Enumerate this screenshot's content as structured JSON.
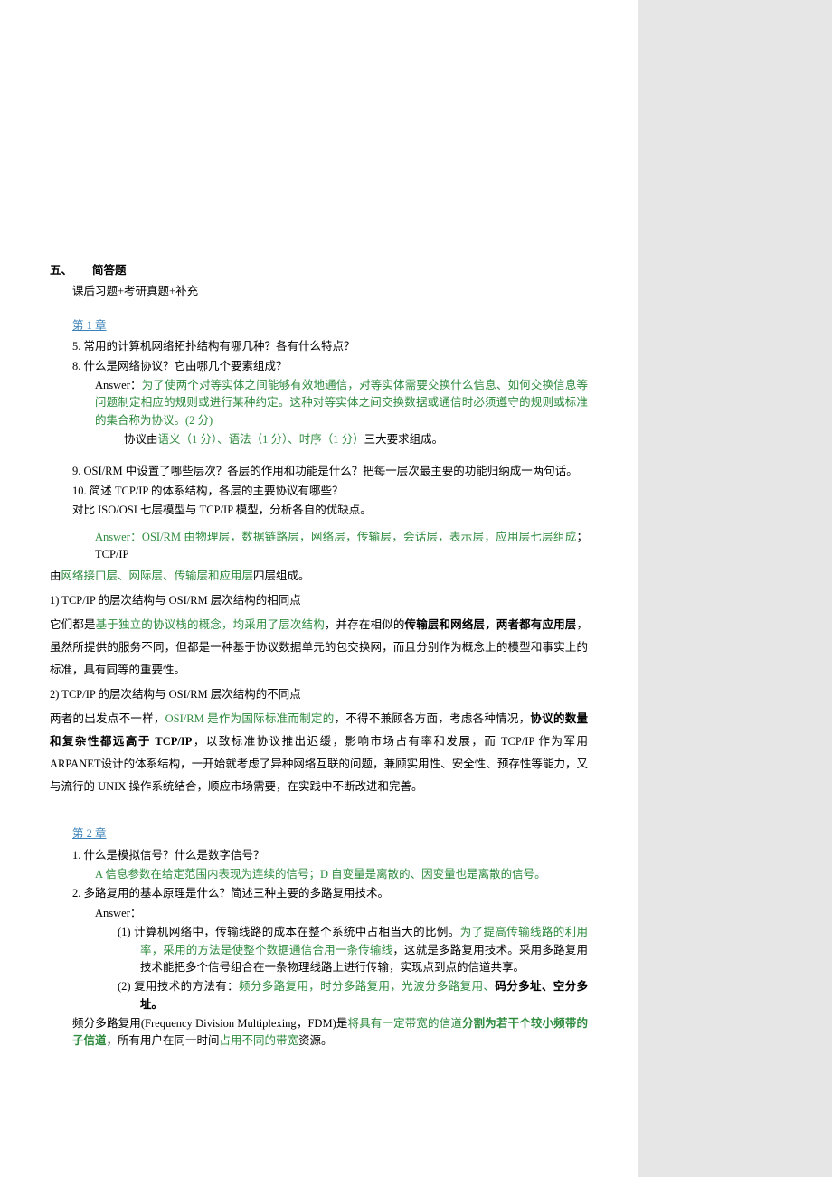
{
  "heading_num": "五、",
  "heading_text": "简答题",
  "subtitle": "课后习题+考研真题+补充",
  "chapter1": {
    "title": "第 1 章",
    "q5": "5.  常用的计算机网络拓扑结构有哪几种？各有什么特点？",
    "q8": "8.  什么是网络协议？它由哪几个要素组成？",
    "ans_label": "Answer：",
    "q8_a1": "为了使两个对等实体之间能够有效地通信，对等实体需要交换什么信息、如何交换信息等问题制定相应的规则或进行某种约定。这种对等实体之间交换数据或通信时必须遵守的规则或标准的集合称为协议。(2 分)",
    "q8_a2_pre": "协议由",
    "q8_a2_green": "语义（1 分）、语法（1 分）、时序（1 分）",
    "q8_a2_post": "三大要求组成。",
    "q9": "9.  OSI/RM 中设置了哪些层次？各层的作用和功能是什么？把每一层次最主要的功能归纳成一两句话。",
    "q10": "10. 简述 TCP/IP 的体系结构，各层的主要协议有哪些？",
    "compare": "对比 ISO/OSI 七层模型与 TCP/IP 模型，分析各自的优缺点。",
    "osi_ans_label": "Answer：",
    "osi_layers": "OSI/RM 由物理层，数据链路层，网络层，传输层，会话层，表示层，应用层七层组成",
    "osi_tcp_suffix": "；TCP/IP",
    "tcp_pre": "由",
    "tcp_layers": "网络接口层、网际层、传输层和应用层",
    "tcp_post": "四层组成。",
    "p1_title": "1) TCP/IP 的层次结构与 OSI/RM 层次结构的相同点",
    "p1_a": "它们都是",
    "p1_b": "基于独立的协议栈的概念，均采用了层次结构",
    "p1_c": "，并存在相似的",
    "p1_d": "传输层和网络层，两者都有应用层",
    "p1_e": "，虽然所提供的服务不同，但都是一种基于协议数据单元的包交换网，而且分别作为概念上的模型和事实上的标准，具有同等的重要性。",
    "p2_title": "2) TCP/IP 的层次结构与 OSI/RM 层次结构的不同点",
    "p2_a": "两者的出发点不一样，",
    "p2_b": "OSI/RM 是作为国际标准而制定的",
    "p2_c": "，不得不兼顾各方面，考虑各种情况，",
    "p2_d": "协议的数量和复杂性都远高于 TCP/IP",
    "p2_e": "，以致标准协议推出迟缓，影响市场占有率和发展，而 TCP/IP 作为军用 ARPANET设计的体系结构，一开始就考虑了异种网络互联的问题，兼顾实用性、安全性、预存性等能力，又与流行的 UNIX 操作系统结合，顺应市场需要，在实践中不断改进和完善。"
  },
  "chapter2": {
    "title": "第 2 章",
    "q1": "1.  什么是模拟信号？什么是数字信号？",
    "q1_ans": "A 信息参数在给定范围内表现为连续的信号；D 自变量是离散的、因变量也是离散的信号。",
    "q2": "2. 多路复用的基本原理是什么？简述三种主要的多路复用技术。",
    "ans_label": "Answer：",
    "i1_label": "(1)",
    "i1_a": " 计算机网络中，传输线路的成本在整个系统中占相当大的比例。",
    "i1_b": "为了提高传输线路的利用率，采用的方法是使整个数据通信合用一条传输线",
    "i1_c": "，这就是多路复用技术。采用多路复用技术能把多个信号组合在一条物理线路上进行传输，实现点到点的信道共享。",
    "i2_label": "(2)",
    "i2_a": " 复用技术的方法有：",
    "i2_b": "频分多路复用，时分多路复用，光波分多路复用、",
    "i2_c": "码分多址、空分多址。",
    "fdm_a": "频分多路复用(Frequency Division Multiplexing，FDM)是",
    "fdm_b": "将具有一定带宽的信道",
    "fdm_c": "分割",
    "fdm_d": "为若干个较小频带的子信道",
    "fdm_e": "，所有用户在同一时间",
    "fdm_f": "占用不同的带宽",
    "fdm_g": "资源。"
  }
}
